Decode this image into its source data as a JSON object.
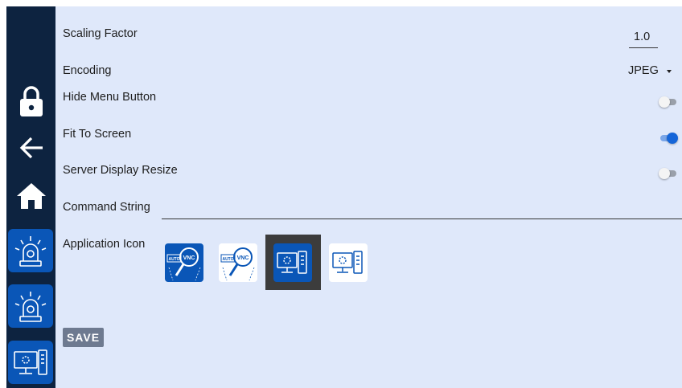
{
  "settings": {
    "scaling_factor": {
      "label": "Scaling Factor",
      "value": "1.0"
    },
    "encoding": {
      "label": "Encoding",
      "value": "JPEG"
    },
    "hide_menu_button": {
      "label": "Hide Menu Button",
      "on": false
    },
    "fit_to_screen": {
      "label": "Fit To Screen",
      "on": true
    },
    "server_display_resize": {
      "label": "Server Display Resize",
      "on": false
    },
    "command_string": {
      "label": "Command String",
      "value": ""
    },
    "application_icon": {
      "label": "Application Icon",
      "options": [
        "autovnc-blue-icon",
        "autovnc-white-icon",
        "monitor-blue-icon",
        "monitor-white-icon"
      ],
      "selected_index": 2,
      "icon_text": {
        "auto": "AUTO",
        "vnc": "VNC"
      }
    }
  },
  "actions": {
    "save_label": "SAVE"
  },
  "sidebar": {
    "items": [
      "lock-icon",
      "back-arrow-icon",
      "home-icon",
      "siren-icon",
      "siren-icon",
      "monitor-icon"
    ]
  },
  "colors": {
    "sidebar": "#0d2340",
    "panel": "#dfe8fa",
    "accent": "#1565d8",
    "tile": "#0a56b7",
    "save": "#6e7a90"
  }
}
